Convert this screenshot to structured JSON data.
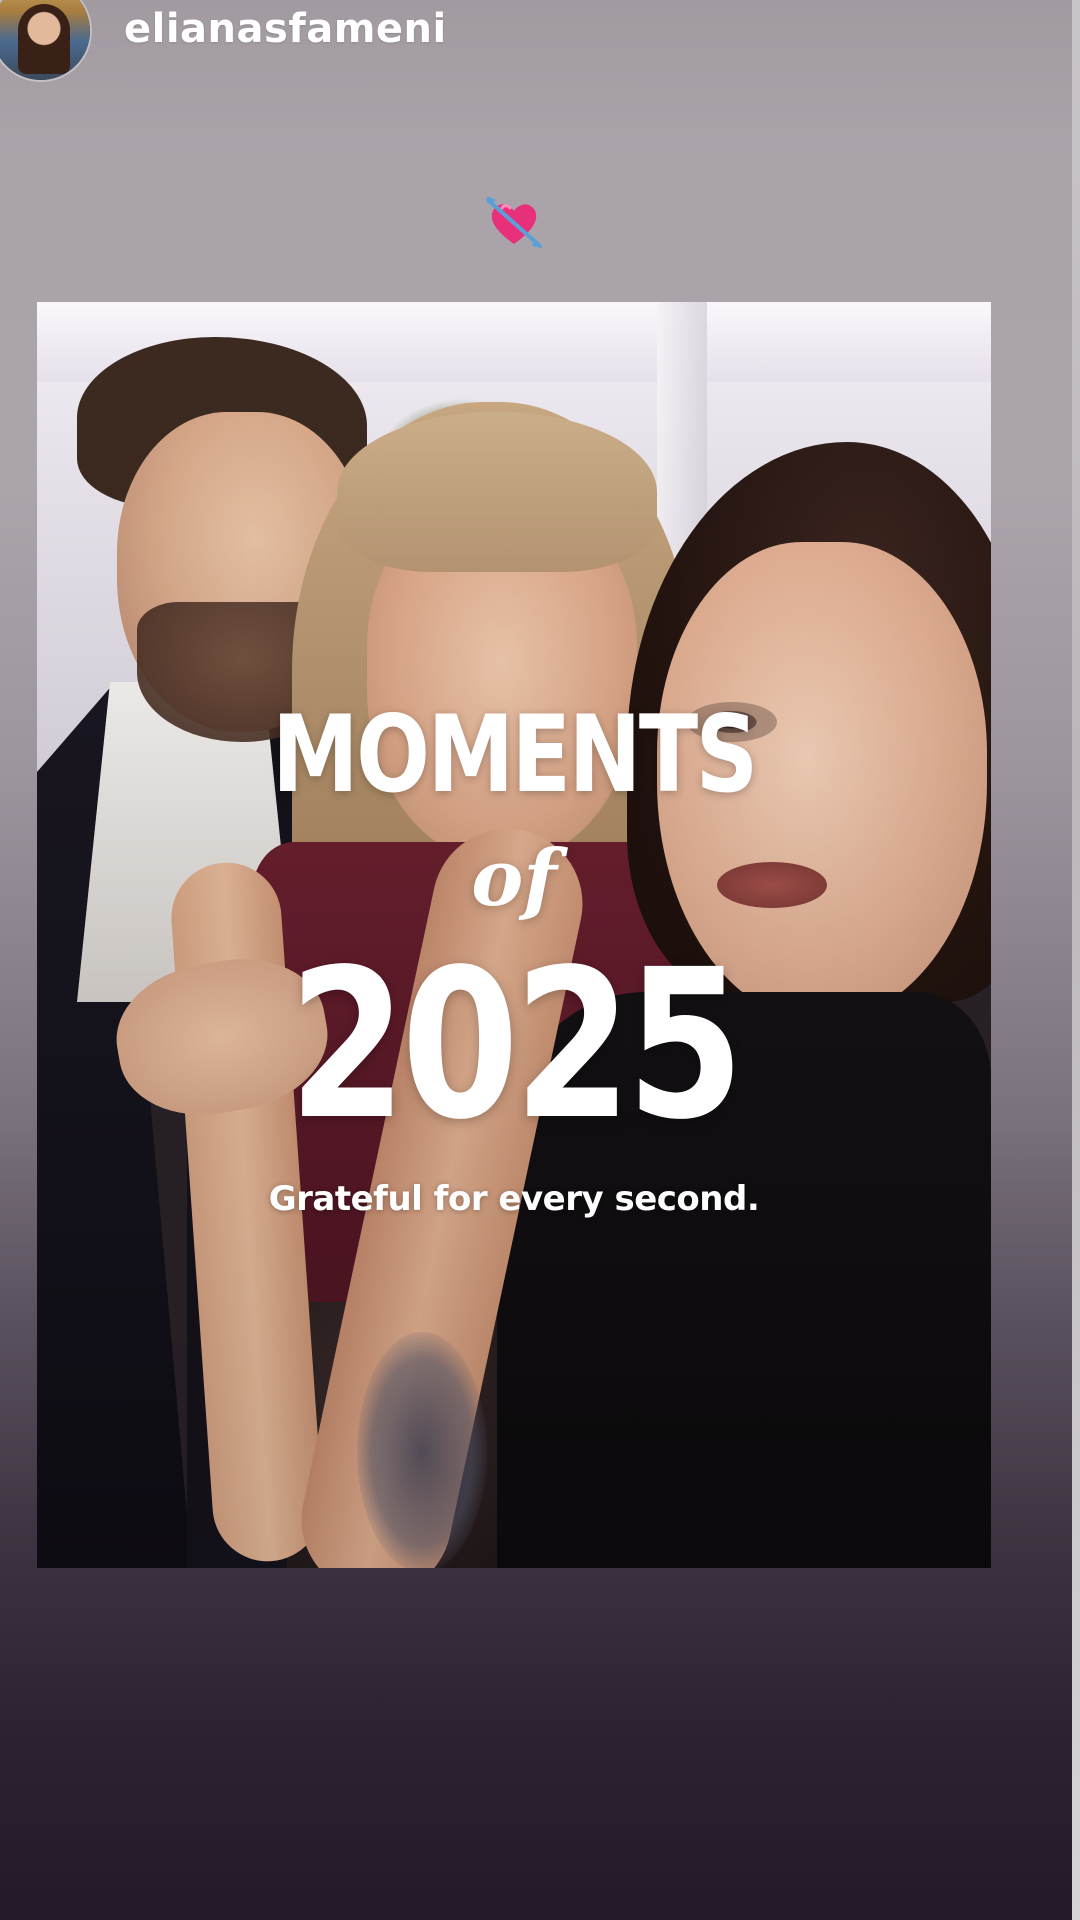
{
  "story": {
    "username": "elianasfameni",
    "sticker_icon": "heart-with-arrow-emoji",
    "overlay": {
      "line1": "MOMENTS",
      "line2": "of",
      "line3": "2025",
      "caption": "Grateful for every second."
    }
  },
  "colors": {
    "background_top": "#a29aa1",
    "background_bottom": "#241a27",
    "text": "#ffffff",
    "sticker_heart": "#e8307a",
    "sticker_arrow": "#5aa0d8"
  }
}
